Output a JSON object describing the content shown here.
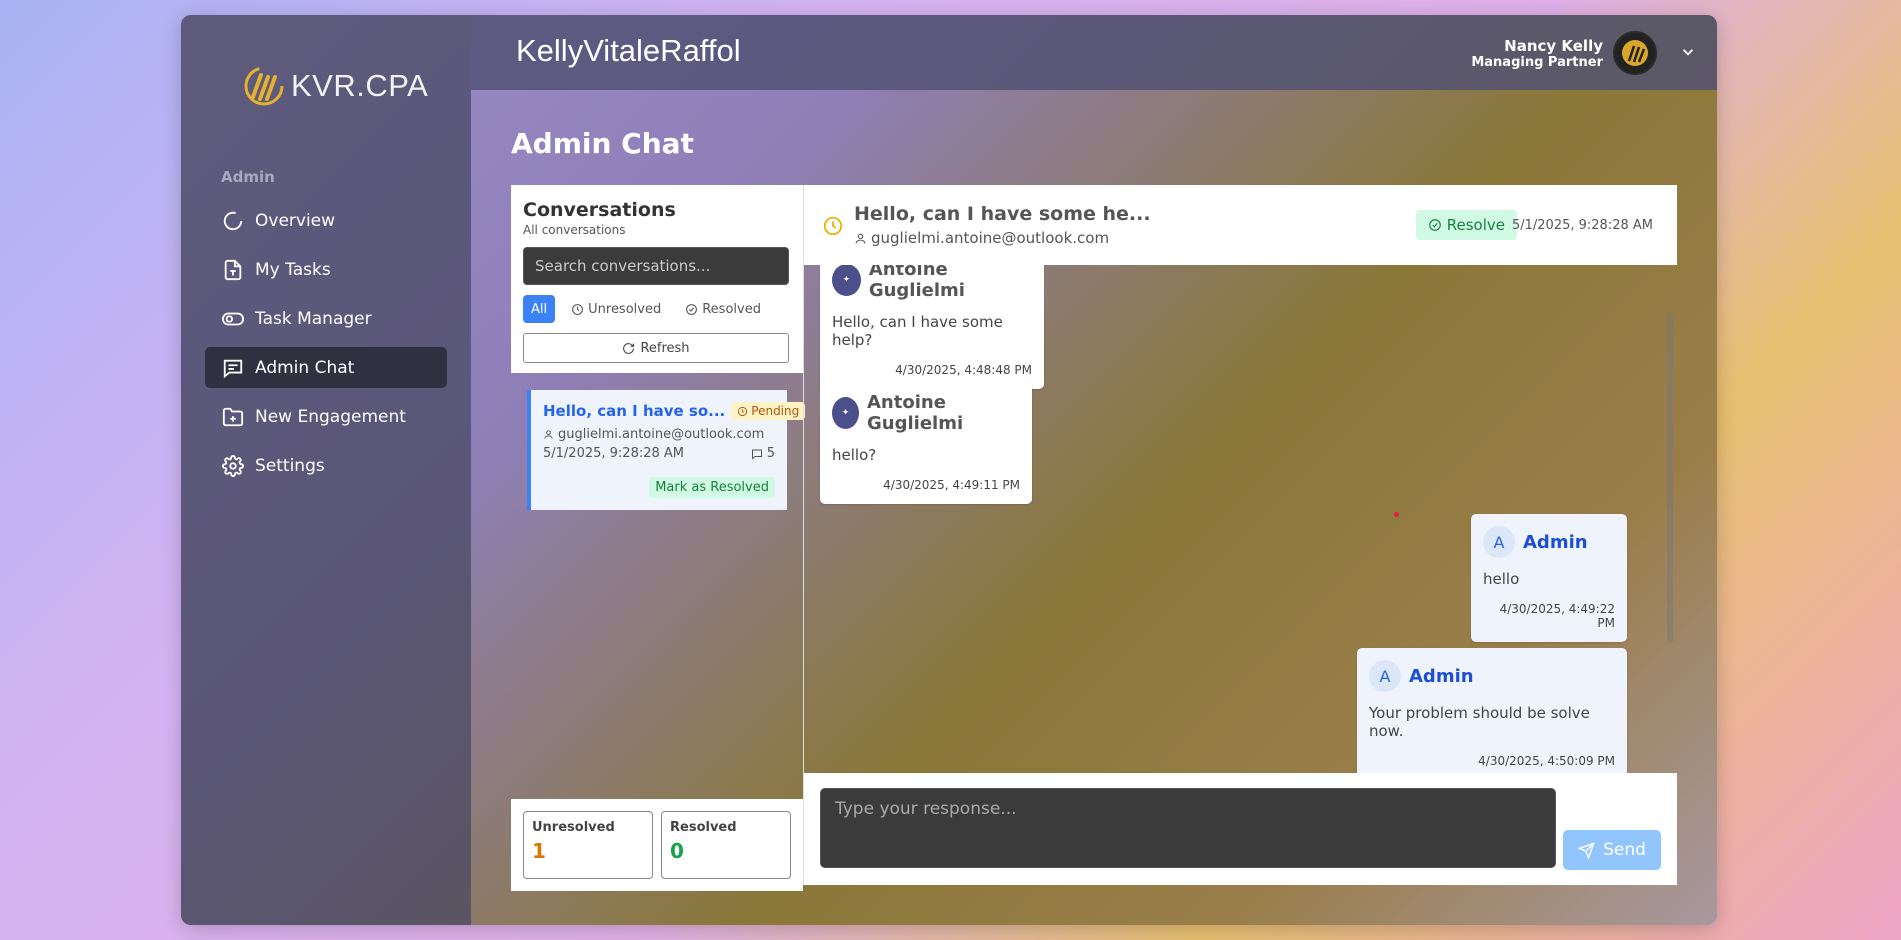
{
  "sidebar": {
    "logo_text": "KVR.CPA",
    "section_label": "Admin",
    "items": [
      {
        "label": "Overview",
        "icon": "loader-icon"
      },
      {
        "label": "My Tasks",
        "icon": "file-task-icon"
      },
      {
        "label": "Task Manager",
        "icon": "toggle-icon"
      },
      {
        "label": "Admin Chat",
        "icon": "chat-icon"
      },
      {
        "label": "New Engagement",
        "icon": "folder-plus-icon"
      },
      {
        "label": "Settings",
        "icon": "gear-icon"
      }
    ],
    "active_index": 3
  },
  "header": {
    "brand": "KellyVitaleRaffol",
    "user_name": "Nancy Kelly",
    "user_role": "Managing Partner"
  },
  "page": {
    "title": "Admin Chat"
  },
  "conversations": {
    "title": "Conversations",
    "subtitle": "All conversations",
    "search_placeholder": "Search conversations...",
    "filters": [
      "All",
      "Unresolved",
      "Resolved"
    ],
    "active_filter": "All",
    "refresh_label": "Refresh",
    "items": [
      {
        "title": "Hello, can I have so...",
        "status": "Pending",
        "email": "guglielmi.antoine@outlook.com",
        "date": "5/1/2025, 9:28:28 AM",
        "count": "5",
        "action": "Mark as Resolved"
      }
    ],
    "stats": {
      "unresolved_label": "Unresolved",
      "unresolved_value": "1",
      "resolved_label": "Resolved",
      "resolved_value": "0"
    }
  },
  "chat": {
    "title": "Hello, can I have some he...",
    "email": "guglielmi.antoine@outlook.com",
    "resolve_label": "Resolve",
    "date": "5/1/2025, 9:28:28 AM",
    "messages": [
      {
        "author": "Antoine Guglielmi",
        "text": "Hello, can I have some help?",
        "time": "4/30/2025, 4:48:48 PM"
      },
      {
        "author": "Antoine Guglielmi",
        "text": "hello?",
        "time": "4/30/2025, 4:49:11 PM"
      },
      {
        "author": "Admin",
        "avatar_letter": "A",
        "text": "hello",
        "time": "4/30/2025, 4:49:22 PM"
      },
      {
        "author": "Admin",
        "avatar_letter": "A",
        "text": "Your problem should be solve now.",
        "time": "4/30/2025, 4:50:09 PM"
      }
    ],
    "reply_placeholder": "Type your response...",
    "send_label": "Send"
  },
  "colors": {
    "accent": "#3b82f6",
    "pending": "#b45309",
    "resolved": "#15803d",
    "unresolved_value": "#d97706",
    "resolved_value": "#16a34a"
  }
}
